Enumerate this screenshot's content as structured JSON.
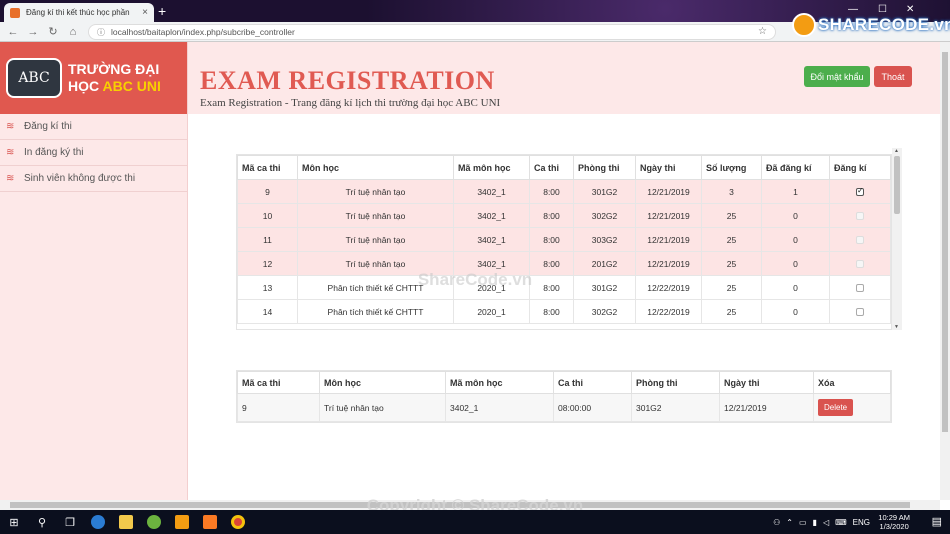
{
  "browser": {
    "tab_title": "Đăng kí thi kết thúc học phần",
    "url": "localhost/baitaplon/index.php/subcribe_controller",
    "brand_logo": "SHARECODE.vn"
  },
  "sidebar": {
    "school_line1": "TRƯỜNG ĐẠI",
    "school_line2_prefix": "HỌC",
    "school_line2_accent": "ABC UNI",
    "logo_text": "ABC",
    "items": [
      {
        "label": "Đăng kí thi",
        "icon": "stack-icon"
      },
      {
        "label": "In đăng ký thi",
        "icon": "stack-icon"
      },
      {
        "label": "Sinh viên không được thi",
        "icon": "stack-icon"
      }
    ]
  },
  "header": {
    "title": "EXAM REGISTRATION",
    "subtitle": "Exam Registration - Trang đăng kí lịch thi trường đại học ABC UNI",
    "change_password_label": "Đổi mật khẩu",
    "logout_label": "Thoát"
  },
  "exam_table": {
    "columns": [
      "Mã ca thi",
      "Môn học",
      "Mã môn học",
      "Ca thi",
      "Phòng thi",
      "Ngày thi",
      "Số lượng",
      "Đã đăng kí",
      "Đăng kí"
    ],
    "rows": [
      {
        "ma_ca": "9",
        "mon": "Trí tuệ nhân tạo",
        "ma_mon": "3402_1",
        "ca": "8:00",
        "phong": "301G2",
        "ngay": "12/21/2019",
        "so_luong": "3",
        "da_dk": "1",
        "state": "checked",
        "highlight": true
      },
      {
        "ma_ca": "10",
        "mon": "Trí tuệ nhân tạo",
        "ma_mon": "3402_1",
        "ca": "8:00",
        "phong": "302G2",
        "ngay": "12/21/2019",
        "so_luong": "25",
        "da_dk": "0",
        "state": "disabled",
        "highlight": true
      },
      {
        "ma_ca": "11",
        "mon": "Trí tuệ nhân tạo",
        "ma_mon": "3402_1",
        "ca": "8:00",
        "phong": "303G2",
        "ngay": "12/21/2019",
        "so_luong": "25",
        "da_dk": "0",
        "state": "disabled",
        "highlight": true
      },
      {
        "ma_ca": "12",
        "mon": "Trí tuệ nhân tạo",
        "ma_mon": "3402_1",
        "ca": "8:00",
        "phong": "201G2",
        "ngay": "12/21/2019",
        "so_luong": "25",
        "da_dk": "0",
        "state": "disabled",
        "highlight": true
      },
      {
        "ma_ca": "13",
        "mon": "Phân tích thiết kế CHTTT",
        "ma_mon": "2020_1",
        "ca": "8:00",
        "phong": "301G2",
        "ngay": "12/22/2019",
        "so_luong": "25",
        "da_dk": "0",
        "state": "unchecked",
        "highlight": false
      },
      {
        "ma_ca": "14",
        "mon": "Phân tích thiết kế CHTTT",
        "ma_mon": "2020_1",
        "ca": "8:00",
        "phong": "302G2",
        "ngay": "12/22/2019",
        "so_luong": "25",
        "da_dk": "0",
        "state": "unchecked",
        "highlight": false
      }
    ]
  },
  "registered_table": {
    "columns": [
      "Mã ca thi",
      "Môn học",
      "Mã môn học",
      "Ca thi",
      "Phòng thi",
      "Ngày thi",
      "Xóa"
    ],
    "rows": [
      {
        "ma_ca": "9",
        "mon": "Trí tuệ nhân tạo",
        "ma_mon": "3402_1",
        "ca": "08:00:00",
        "phong": "301G2",
        "ngay": "12/21/2019",
        "delete_label": "Delete"
      }
    ]
  },
  "watermark": {
    "center": "ShareCode.vn",
    "bottom": "Copyright © ShareCode.vn"
  },
  "taskbar": {
    "lang": "ENG",
    "time": "10:29 AM",
    "date": "1/3/2020"
  },
  "colors": {
    "accent_red": "#e0584f",
    "title_red": "#e05a52",
    "sidebar_bg": "#fde8e8",
    "success_green": "#4cae4c",
    "danger_red": "#d9534f"
  }
}
